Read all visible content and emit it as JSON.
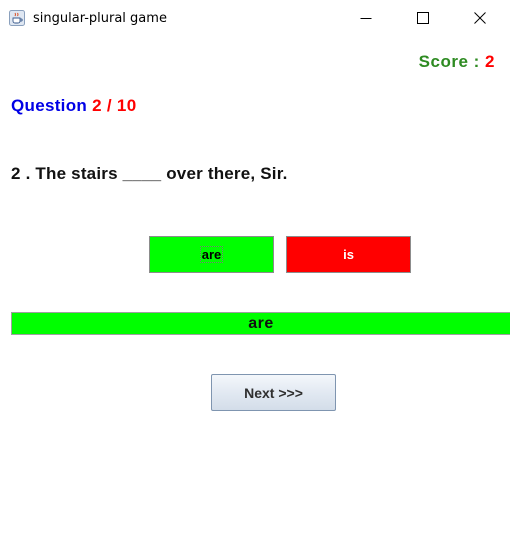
{
  "window": {
    "title": "singular-plural game",
    "app_icon": "java-coffee-cup-icon",
    "controls": [
      "minimize-icon",
      "maximize-icon",
      "close-icon"
    ]
  },
  "score": {
    "label": "Score :",
    "value": "2"
  },
  "question": {
    "label": "Question",
    "progress": "2 / 10",
    "text": "2 . The stairs ____ over there, Sir."
  },
  "choices": [
    {
      "label": "are",
      "state": "correct",
      "color": "#00ff00"
    },
    {
      "label": "is",
      "state": "wrong",
      "color": "#ff0000"
    }
  ],
  "answer": {
    "text": "are",
    "color": "#00ff00"
  },
  "next_button": {
    "label": "Next >>>"
  },
  "colors": {
    "score_label": "#2e8b22",
    "question_label": "#0000e6",
    "highlight_red": "#ff0000"
  }
}
